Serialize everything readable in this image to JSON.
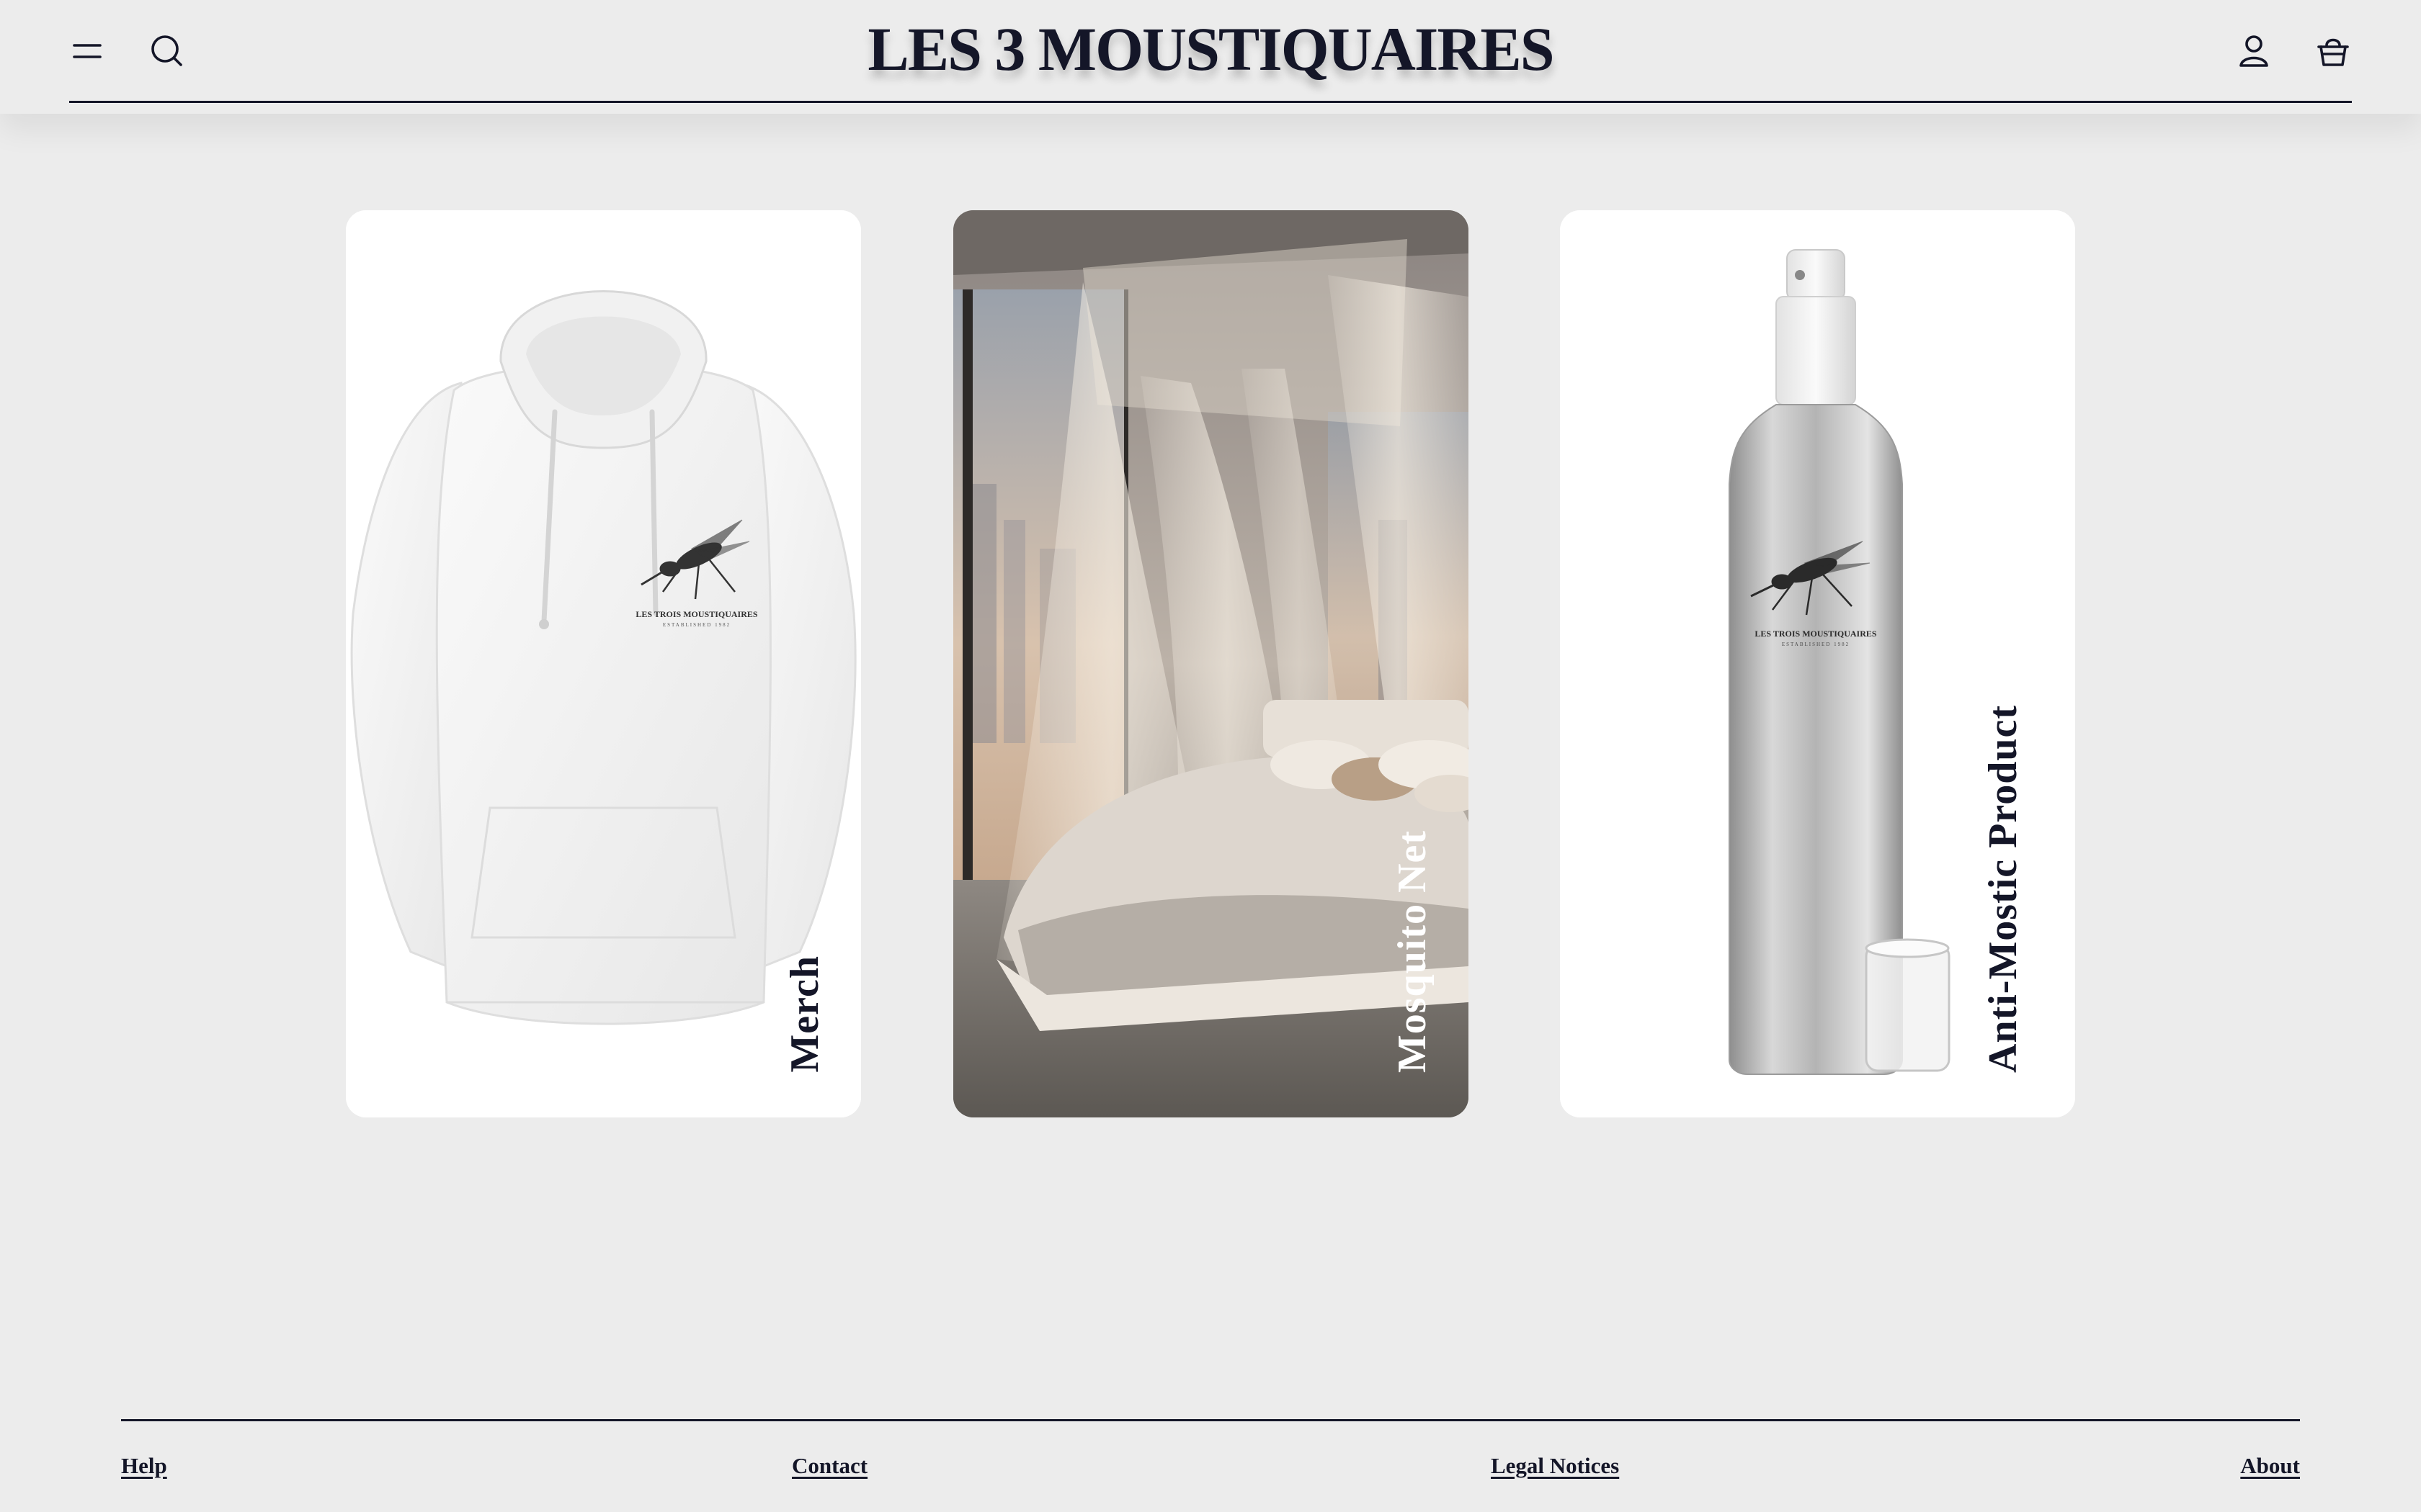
{
  "header": {
    "brand": "LES 3 MOUSTIQUAIRES",
    "icons": {
      "menu": "hamburger-menu-icon",
      "search": "search-icon",
      "account": "user-icon",
      "cart": "basket-icon"
    }
  },
  "categories": [
    {
      "label": "Merch",
      "image": "white-hoodie-with-mosquito-logo"
    },
    {
      "label": "Mosquito Net",
      "image": "canopy-bed-with-mosquito-net"
    },
    {
      "label": "Anti-Mostic Product",
      "image": "aluminium-spray-bottle-with-cap"
    }
  ],
  "logo_text": {
    "name": "LES TROIS MOUSTIQUAIRES",
    "tagline": "ESTABLISHED 1982"
  },
  "footer": {
    "links": [
      "Help",
      "Contact",
      "Legal Notices",
      "About"
    ]
  },
  "colors": {
    "background": "#ececec",
    "ink": "#141628",
    "card": "#ffffff"
  }
}
